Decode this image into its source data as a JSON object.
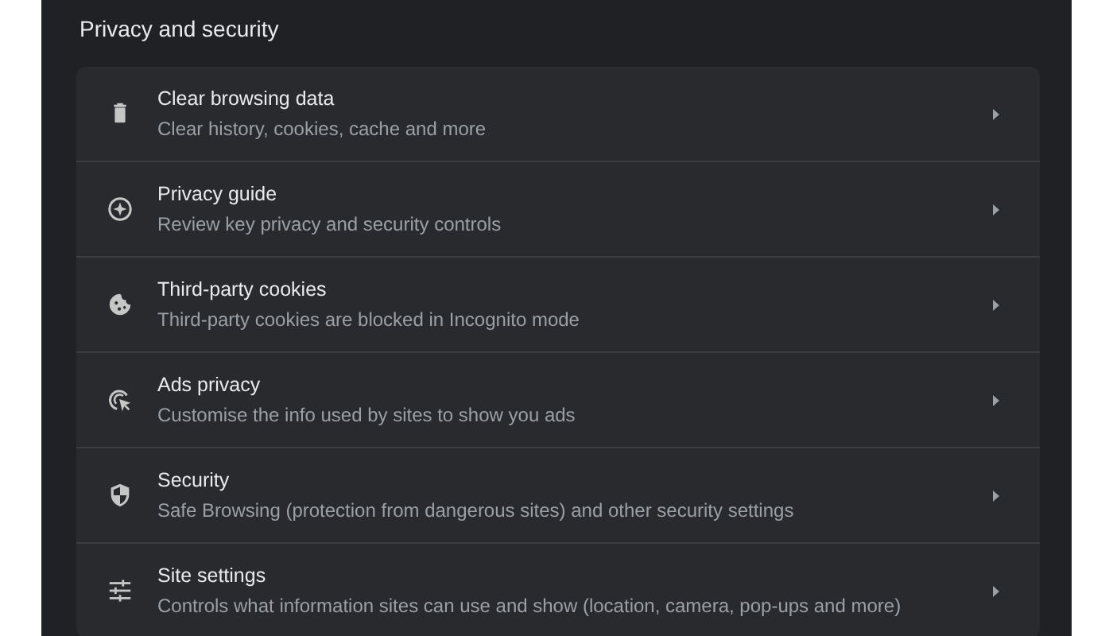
{
  "section": {
    "title": "Privacy and security"
  },
  "items": [
    {
      "title": "Clear browsing data",
      "subtitle": "Clear history, cookies, cache and more"
    },
    {
      "title": "Privacy guide",
      "subtitle": "Review key privacy and security controls"
    },
    {
      "title": "Third-party cookies",
      "subtitle": "Third-party cookies are blocked in Incognito mode"
    },
    {
      "title": "Ads privacy",
      "subtitle": "Customise the info used by sites to show you ads"
    },
    {
      "title": "Security",
      "subtitle": "Safe Browsing (protection from dangerous sites) and other security settings"
    },
    {
      "title": "Site settings",
      "subtitle": "Controls what information sites can use and show (location, camera, pop-ups and more)"
    }
  ]
}
